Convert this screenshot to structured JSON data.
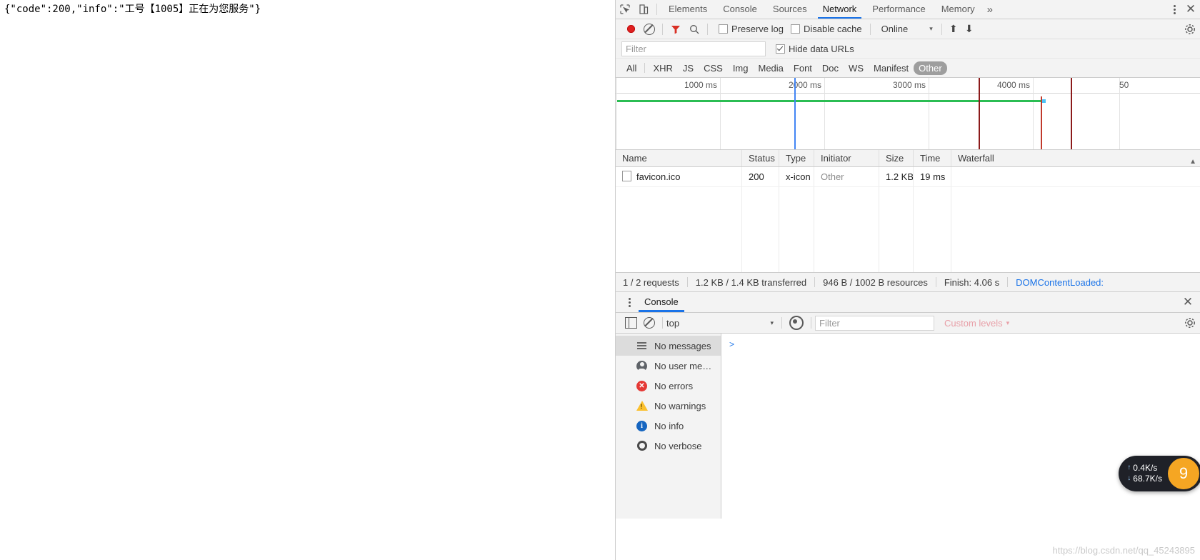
{
  "page": {
    "response_text": "{\"code\":200,\"info\":\"工号【1005】正在为您服务\"}"
  },
  "devtools": {
    "tabs": [
      {
        "label": "Elements",
        "active": false
      },
      {
        "label": "Console",
        "active": false
      },
      {
        "label": "Sources",
        "active": false
      },
      {
        "label": "Network",
        "active": true
      },
      {
        "label": "Performance",
        "active": false
      },
      {
        "label": "Memory",
        "active": false
      }
    ],
    "more_tabs_label": "»",
    "inspect_icon": "inspect-element-icon",
    "device_icon": "toggle-device-toolbar-icon",
    "close_icon": "✕",
    "network_toolbar": {
      "record_label": "record-button",
      "clear_label": "clear-button",
      "filter_toggle_label": "filter-toggle",
      "search_label": "search-button",
      "preserve_log": "Preserve log",
      "preserve_log_checked": false,
      "disable_cache": "Disable cache",
      "disable_cache_checked": false,
      "throttling": "Online",
      "caret": "▾",
      "import_icon": "⬆",
      "export_icon": "⬇",
      "settings_icon": "gear-icon"
    },
    "filter_row": {
      "filter_value": "",
      "filter_placeholder": "Filter",
      "hide_data_urls": "Hide data URLs",
      "hide_data_urls_checked": true
    },
    "type_filters": [
      {
        "label": "All",
        "selected": false
      },
      {
        "label": "XHR",
        "selected": false
      },
      {
        "label": "JS",
        "selected": false
      },
      {
        "label": "CSS",
        "selected": false
      },
      {
        "label": "Img",
        "selected": false
      },
      {
        "label": "Media",
        "selected": false
      },
      {
        "label": "Font",
        "selected": false
      },
      {
        "label": "Doc",
        "selected": false
      },
      {
        "label": "WS",
        "selected": false
      },
      {
        "label": "Manifest",
        "selected": false
      },
      {
        "label": "Other",
        "selected": true
      }
    ],
    "overview": {
      "ticks": [
        "1000 ms",
        "2000 ms",
        "3000 ms",
        "4000 ms",
        "50"
      ],
      "dom_content_loaded_color": "#2bbd53",
      "load_event_color": "#4285f4",
      "selection_color": "#8b1a1a"
    },
    "requests_table": {
      "columns": [
        "Name",
        "Status",
        "Type",
        "Initiator",
        "Size",
        "Time",
        "Waterfall"
      ],
      "rows": [
        {
          "name": "favicon.ico",
          "status": "200",
          "type": "x-icon",
          "initiator": "Other",
          "size": "1.2 KB",
          "time": "19 ms",
          "waterfall": ""
        }
      ]
    },
    "status_bar": {
      "requests": "1 / 2 requests",
      "transferred": "1.2 KB / 1.4 KB transferred",
      "resources": "946 B / 1002 B resources",
      "finish": "Finish: 4.06 s",
      "dom_content_loaded": "DOMContentLoaded:"
    },
    "drawer": {
      "tab_label": "Console",
      "kebab_icon": "more-options-icon",
      "close_icon": "✕",
      "toolbar": {
        "sidebar_toggle": "console-sidebar-toggle",
        "clear_label": "clear-console",
        "context": "top",
        "context_caret": "▾",
        "eye_icon": "live-expression-icon",
        "filter_value": "",
        "filter_placeholder": "Filter",
        "levels": "Custom levels",
        "levels_caret": "▾",
        "settings_icon": "gear-icon"
      },
      "sidebar_items": [
        {
          "label": "No messages",
          "icon": "list-icon",
          "selected": true
        },
        {
          "label": "No user me…",
          "icon": "person-icon",
          "selected": false
        },
        {
          "label": "No errors",
          "icon": "error-icon",
          "selected": false
        },
        {
          "label": "No warnings",
          "icon": "warning-icon",
          "selected": false
        },
        {
          "label": "No info",
          "icon": "info-icon",
          "selected": false
        },
        {
          "label": "No verbose",
          "icon": "verbose-icon",
          "selected": false
        }
      ],
      "prompt": ">"
    }
  },
  "net_widget": {
    "upload": "0.4K/s",
    "download": "68.7K/s",
    "upload_arrow": "↑",
    "download_arrow": "↓",
    "badge": "9"
  },
  "watermark": "https://blog.csdn.net/qq_45243895"
}
